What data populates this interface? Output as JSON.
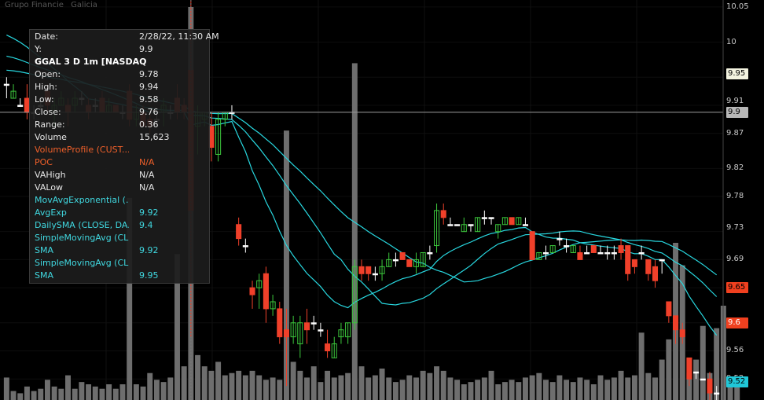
{
  "header": {
    "symbol_desc": "Grupo Financie",
    "company": "Galicia"
  },
  "tooltip": {
    "rows": [
      {
        "label": "Date:",
        "value": "2/28/22, 11:30 AM",
        "color": "#e6e6e6"
      },
      {
        "label": "Y:",
        "value": "9.9",
        "color": "#e6e6e6"
      },
      {
        "label": "GGAL 3 D 1m [NASDAQ",
        "value": "",
        "color": "#ffffff",
        "title": true
      },
      {
        "label": "Open:",
        "value": "9.78",
        "color": "#e6e6e6"
      },
      {
        "label": "High:",
        "value": "9.94",
        "color": "#e6e6e6"
      },
      {
        "label": "Low:",
        "value": "9.58",
        "color": "#e6e6e6"
      },
      {
        "label": "Close:",
        "value": "9.76",
        "color": "#e6e6e6"
      },
      {
        "label": "Range:",
        "value": "0.36",
        "color": "#e6e6e6"
      },
      {
        "label": "Volume",
        "value": "15,623",
        "color": "#e6e6e6"
      },
      {
        "label": "VolumeProfile (CUST...",
        "value": "",
        "color": "#f0602a"
      },
      {
        "label": "POC",
        "value": "N/A",
        "color": "#f0602a"
      },
      {
        "label": "VAHigh",
        "value": "N/A",
        "color": "#e6e6e6"
      },
      {
        "label": "VALow",
        "value": "N/A",
        "color": "#e6e6e6"
      },
      {
        "label": "MovAvgExponential (...",
        "value": "",
        "color": "#40d8e0"
      },
      {
        "label": "AvgExp",
        "value": "9.92",
        "color": "#40d8e0"
      },
      {
        "label": "DailySMA (CLOSE, DA...",
        "value": "9.4",
        "color": "#40d8e0"
      },
      {
        "label": "SimpleMovingAvg (CL...",
        "value": "",
        "color": "#40d8e0"
      },
      {
        "label": "SMA",
        "value": "9.92",
        "color": "#40d8e0"
      },
      {
        "label": "SimpleMovingAvg (CL...",
        "value": "",
        "color": "#40d8e0"
      },
      {
        "label": "SMA",
        "value": "9.95",
        "color": "#40d8e0"
      }
    ]
  },
  "axis": {
    "ticks": [
      "10.05",
      "10",
      "9.95",
      "9.91",
      "9.9",
      "9.87",
      "9.82",
      "9.78",
      "9.73",
      "9.69",
      "9.65",
      "9.6",
      "9.56",
      "9.52"
    ],
    "markers": [
      {
        "label": "9.95",
        "bg": "#f3f3e0",
        "fg": "#000000"
      },
      {
        "label": "9.9",
        "bg": "#b8b8b8",
        "fg": "#000000"
      },
      {
        "label": "9.65",
        "bg": "#f0401f",
        "fg": "#000000"
      },
      {
        "label": "9.6",
        "bg": "#f0401f",
        "fg": "#ffffff"
      },
      {
        "label": "9.52",
        "bg": "#20c8d8",
        "fg": "#000000"
      }
    ]
  },
  "colors": {
    "up": "#3cc83c",
    "down": "#f0402a",
    "doji": "#ffffff",
    "volume": "#6e6e6e",
    "ma": "#28d8e0"
  },
  "chart_data": {
    "type": "candlestick",
    "ylim": [
      9.49,
      10.06
    ],
    "crosshair_y": 9.9,
    "candles": [
      {
        "o": 9.94,
        "h": 9.95,
        "l": 9.92,
        "c": 9.94
      },
      {
        "o": 9.92,
        "h": 9.94,
        "l": 9.92,
        "c": 9.93
      },
      {
        "o": 9.91,
        "h": 9.92,
        "l": 9.91,
        "c": 9.91
      },
      {
        "o": 9.92,
        "h": 9.94,
        "l": 9.89,
        "c": 9.9
      },
      {
        "o": 9.9,
        "h": 9.91,
        "l": 9.89,
        "c": 9.9
      },
      {
        "o": 9.91,
        "h": 9.92,
        "l": 9.9,
        "c": 9.91
      },
      {
        "o": 9.93,
        "h": 9.94,
        "l": 9.9,
        "c": 9.91
      },
      {
        "o": 9.9,
        "h": 9.92,
        "l": 9.88,
        "c": 9.91
      },
      {
        "o": 9.91,
        "h": 9.93,
        "l": 9.91,
        "c": 9.92
      },
      {
        "o": 9.91,
        "h": 9.92,
        "l": 9.88,
        "c": 9.9
      },
      {
        "o": 9.91,
        "h": 9.93,
        "l": 9.9,
        "c": 9.92
      },
      {
        "o": 9.92,
        "h": 9.93,
        "l": 9.91,
        "c": 9.92
      },
      {
        "o": 9.91,
        "h": 9.92,
        "l": 9.89,
        "c": 9.9
      },
      {
        "o": 9.91,
        "h": 9.92,
        "l": 9.9,
        "c": 9.91
      },
      {
        "o": 9.92,
        "h": 9.93,
        "l": 9.9,
        "c": 9.9
      },
      {
        "o": 9.9,
        "h": 9.92,
        "l": 9.9,
        "c": 9.91
      },
      {
        "o": 9.91,
        "h": 9.91,
        "l": 9.9,
        "c": 9.9
      },
      {
        "o": 9.9,
        "h": 9.91,
        "l": 9.89,
        "c": 9.9
      },
      {
        "o": 9.93,
        "h": 9.94,
        "l": 9.88,
        "c": 9.89
      },
      {
        "o": 9.89,
        "h": 9.91,
        "l": 9.88,
        "c": 9.9
      },
      {
        "o": 9.9,
        "h": 9.91,
        "l": 9.88,
        "c": 9.88
      },
      {
        "o": 9.89,
        "h": 9.9,
        "l": 9.87,
        "c": 9.88
      },
      {
        "o": 9.89,
        "h": 9.9,
        "l": 9.88,
        "c": 9.89
      },
      {
        "o": 9.9,
        "h": 9.92,
        "l": 9.88,
        "c": 9.91
      },
      {
        "o": 9.9,
        "h": 9.91,
        "l": 9.89,
        "c": 9.9
      },
      {
        "o": 9.92,
        "h": 9.94,
        "l": 9.89,
        "c": 9.9
      },
      {
        "o": 9.91,
        "h": 9.92,
        "l": 9.89,
        "c": 9.9
      },
      {
        "o": 9.96,
        "h": 10.06,
        "l": 9.58,
        "c": 9.76
      },
      {
        "o": 9.88,
        "h": 9.91,
        "l": 9.84,
        "c": 9.9
      },
      {
        "o": 9.89,
        "h": 9.9,
        "l": 9.88,
        "c": 9.9
      },
      {
        "o": 9.88,
        "h": 9.9,
        "l": 9.83,
        "c": 9.85
      },
      {
        "o": 9.84,
        "h": 9.9,
        "l": 9.83,
        "c": 9.89
      },
      {
        "o": 9.89,
        "h": 9.9,
        "l": 9.88,
        "c": 9.9
      },
      {
        "o": 9.9,
        "h": 9.91,
        "l": 9.89,
        "c": 9.9
      },
      {
        "o": 9.74,
        "h": 9.75,
        "l": 9.71,
        "c": 9.72
      },
      {
        "o": 9.71,
        "h": 9.72,
        "l": 9.7,
        "c": 9.71
      },
      {
        "o": 9.65,
        "h": 9.66,
        "l": 9.62,
        "c": 9.64
      },
      {
        "o": 9.65,
        "h": 9.67,
        "l": 9.62,
        "c": 9.66
      },
      {
        "o": 9.67,
        "h": 9.68,
        "l": 9.6,
        "c": 9.62
      },
      {
        "o": 9.62,
        "h": 9.64,
        "l": 9.61,
        "c": 9.63
      },
      {
        "o": 9.62,
        "h": 9.63,
        "l": 9.57,
        "c": 9.58
      },
      {
        "o": 9.59,
        "h": 9.62,
        "l": 9.51,
        "c": 9.58
      },
      {
        "o": 9.58,
        "h": 9.61,
        "l": 9.57,
        "c": 9.6
      },
      {
        "o": 9.57,
        "h": 9.61,
        "l": 9.55,
        "c": 9.6
      },
      {
        "o": 9.6,
        "h": 9.62,
        "l": 9.57,
        "c": 9.59
      },
      {
        "o": 9.6,
        "h": 9.61,
        "l": 9.59,
        "c": 9.6
      },
      {
        "o": 9.59,
        "h": 9.6,
        "l": 9.58,
        "c": 9.59
      },
      {
        "o": 9.57,
        "h": 9.59,
        "l": 9.55,
        "c": 9.56
      },
      {
        "o": 9.55,
        "h": 9.58,
        "l": 9.55,
        "c": 9.57
      },
      {
        "o": 9.58,
        "h": 9.6,
        "l": 9.57,
        "c": 9.59
      },
      {
        "o": 9.58,
        "h": 9.6,
        "l": 9.57,
        "c": 9.6
      },
      {
        "o": 9.6,
        "h": 9.69,
        "l": 9.59,
        "c": 9.68
      },
      {
        "o": 9.68,
        "h": 9.69,
        "l": 9.66,
        "c": 9.67
      },
      {
        "o": 9.68,
        "h": 9.68,
        "l": 9.66,
        "c": 9.67
      },
      {
        "o": 9.67,
        "h": 9.68,
        "l": 9.66,
        "c": 9.67
      },
      {
        "o": 9.67,
        "h": 9.69,
        "l": 9.66,
        "c": 9.68
      },
      {
        "o": 9.68,
        "h": 9.7,
        "l": 9.68,
        "c": 9.69
      },
      {
        "o": 9.69,
        "h": 9.7,
        "l": 9.68,
        "c": 9.69
      },
      {
        "o": 9.7,
        "h": 9.7,
        "l": 9.69,
        "c": 9.69
      },
      {
        "o": 9.69,
        "h": 9.69,
        "l": 9.68,
        "c": 9.68
      },
      {
        "o": 9.68,
        "h": 9.7,
        "l": 9.67,
        "c": 9.69
      },
      {
        "o": 9.68,
        "h": 9.7,
        "l": 9.68,
        "c": 9.7
      },
      {
        "o": 9.7,
        "h": 9.71,
        "l": 9.69,
        "c": 9.7
      },
      {
        "o": 9.71,
        "h": 9.77,
        "l": 9.7,
        "c": 9.76
      },
      {
        "o": 9.76,
        "h": 9.77,
        "l": 9.74,
        "c": 9.75
      },
      {
        "o": 9.74,
        "h": 9.75,
        "l": 9.74,
        "c": 9.74
      },
      {
        "o": 9.74,
        "h": 9.74,
        "l": 9.74,
        "c": 9.74
      },
      {
        "o": 9.73,
        "h": 9.75,
        "l": 9.73,
        "c": 9.74
      },
      {
        "o": 9.74,
        "h": 9.74,
        "l": 9.73,
        "c": 9.74
      },
      {
        "o": 9.73,
        "h": 9.75,
        "l": 9.73,
        "c": 9.75
      },
      {
        "o": 9.75,
        "h": 9.76,
        "l": 9.74,
        "c": 9.75
      },
      {
        "o": 9.75,
        "h": 9.75,
        "l": 9.74,
        "c": 9.75
      },
      {
        "o": 9.73,
        "h": 9.74,
        "l": 9.72,
        "c": 9.74
      },
      {
        "o": 9.74,
        "h": 9.75,
        "l": 9.74,
        "c": 9.75
      },
      {
        "o": 9.75,
        "h": 9.75,
        "l": 9.74,
        "c": 9.74
      },
      {
        "o": 9.74,
        "h": 9.75,
        "l": 9.74,
        "c": 9.75
      },
      {
        "o": 9.74,
        "h": 9.75,
        "l": 9.74,
        "c": 9.74
      },
      {
        "o": 9.73,
        "h": 9.73,
        "l": 9.69,
        "c": 9.69
      },
      {
        "o": 9.69,
        "h": 9.7,
        "l": 9.69,
        "c": 9.7
      },
      {
        "o": 9.7,
        "h": 9.71,
        "l": 9.69,
        "c": 9.7
      },
      {
        "o": 9.7,
        "h": 9.71,
        "l": 9.7,
        "c": 9.71
      },
      {
        "o": 9.72,
        "h": 9.73,
        "l": 9.71,
        "c": 9.72
      },
      {
        "o": 9.71,
        "h": 9.72,
        "l": 9.7,
        "c": 9.71
      },
      {
        "o": 9.7,
        "h": 9.71,
        "l": 9.7,
        "c": 9.71
      },
      {
        "o": 9.7,
        "h": 9.71,
        "l": 9.69,
        "c": 9.69
      },
      {
        "o": 9.7,
        "h": 9.71,
        "l": 9.7,
        "c": 9.7
      },
      {
        "o": 9.71,
        "h": 9.71,
        "l": 9.7,
        "c": 9.7
      },
      {
        "o": 9.7,
        "h": 9.71,
        "l": 9.7,
        "c": 9.7
      },
      {
        "o": 9.7,
        "h": 9.71,
        "l": 9.69,
        "c": 9.7
      },
      {
        "o": 9.7,
        "h": 9.71,
        "l": 9.69,
        "c": 9.7
      },
      {
        "o": 9.71,
        "h": 9.72,
        "l": 9.69,
        "c": 9.7
      },
      {
        "o": 9.71,
        "h": 9.71,
        "l": 9.66,
        "c": 9.67
      },
      {
        "o": 9.69,
        "h": 9.69,
        "l": 9.67,
        "c": 9.68
      },
      {
        "o": 9.7,
        "h": 9.71,
        "l": 9.69,
        "c": 9.7
      },
      {
        "o": 9.69,
        "h": 9.69,
        "l": 9.66,
        "c": 9.67
      },
      {
        "o": 9.68,
        "h": 9.69,
        "l": 9.65,
        "c": 9.66
      },
      {
        "o": 9.69,
        "h": 9.69,
        "l": 9.67,
        "c": 9.69
      },
      {
        "o": 9.63,
        "h": 9.63,
        "l": 9.6,
        "c": 9.61
      },
      {
        "o": 9.61,
        "h": 9.61,
        "l": 9.57,
        "c": 9.59
      },
      {
        "o": 9.59,
        "h": 9.6,
        "l": 9.57,
        "c": 9.58
      },
      {
        "o": 9.55,
        "h": 9.55,
        "l": 9.51,
        "c": 9.52
      },
      {
        "o": 9.53,
        "h": 9.53,
        "l": 9.52,
        "c": 9.53
      },
      {
        "o": 9.52,
        "h": 9.52,
        "l": 9.52,
        "c": 9.52
      },
      {
        "o": 9.52,
        "h": 9.53,
        "l": 9.49,
        "c": 9.5
      },
      {
        "o": 9.5,
        "h": 9.51,
        "l": 9.49,
        "c": 9.5
      }
    ],
    "volume": [
      20,
      8,
      6,
      12,
      8,
      10,
      18,
      12,
      10,
      22,
      10,
      16,
      14,
      12,
      10,
      14,
      10,
      14,
      180,
      14,
      12,
      24,
      18,
      16,
      20,
      130,
      30,
      350,
      40,
      30,
      26,
      34,
      22,
      24,
      26,
      22,
      26,
      22,
      18,
      20,
      18,
      240,
      34,
      26,
      20,
      30,
      16,
      26,
      20,
      22,
      24,
      300,
      30,
      20,
      22,
      28,
      20,
      16,
      18,
      22,
      20,
      26,
      24,
      30,
      26,
      20,
      18,
      14,
      16,
      18,
      20,
      26,
      14,
      16,
      18,
      16,
      20,
      22,
      24,
      18,
      16,
      22,
      18,
      16,
      20,
      18,
      14,
      22,
      18,
      20,
      26,
      20,
      22,
      60,
      24,
      20,
      36,
      54,
      140,
      120,
      24,
      36,
      66,
      24,
      64,
      84,
      16,
      16
    ]
  }
}
